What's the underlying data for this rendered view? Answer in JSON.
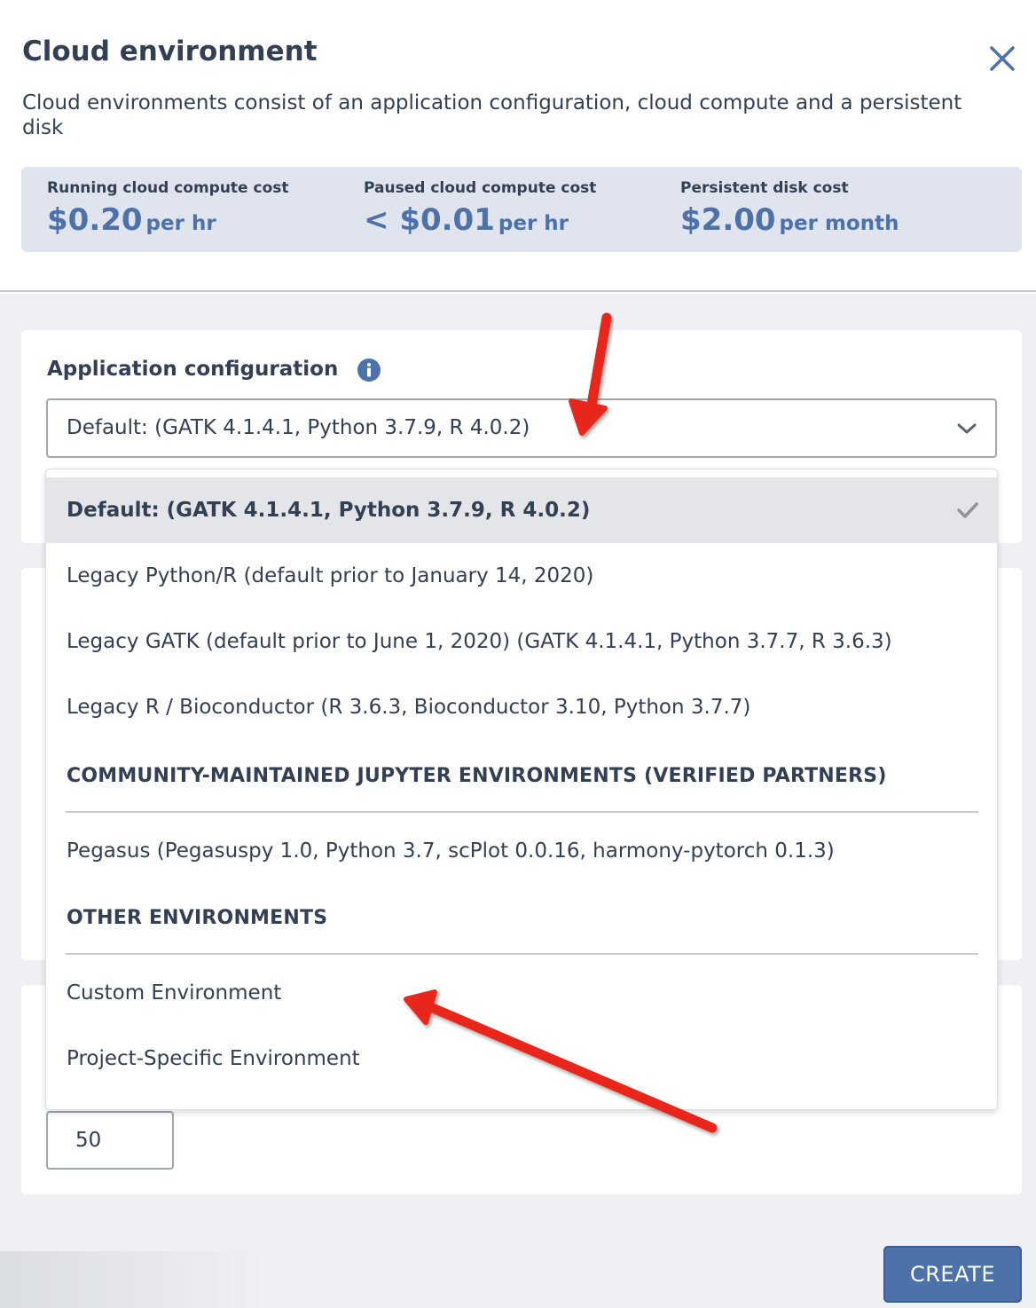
{
  "header": {
    "title": "Cloud environment",
    "description": "Cloud environments consist of an application configuration, cloud compute and a persistent disk"
  },
  "costs": [
    {
      "label": "Running cloud compute cost",
      "value": "$0.20",
      "unit": "per hr"
    },
    {
      "label": "Paused cloud compute cost",
      "value": "< $0.01",
      "unit": "per hr"
    },
    {
      "label": "Persistent disk cost",
      "value": "$2.00",
      "unit": "per month"
    }
  ],
  "app_config": {
    "label": "Application configuration",
    "selected_value": "Default: (GATK 4.1.4.1, Python 3.7.9, R 4.0.2)"
  },
  "dropdown": {
    "options": [
      "Default: (GATK 4.1.4.1, Python 3.7.9, R 4.0.2)",
      "Legacy Python/R (default prior to January 14, 2020)",
      "Legacy GATK (default prior to June 1, 2020) (GATK 4.1.4.1, Python 3.7.7, R 3.6.3)",
      "Legacy R / Bioconductor (R 3.6.3, Bioconductor 3.10, Python 3.7.7)"
    ],
    "community_header": "COMMUNITY-MAINTAINED JUPYTER ENVIRONMENTS (VERIFIED PARTNERS)",
    "community_options": [
      "Pegasus (Pegasuspy 1.0, Python 3.7, scPlot 0.0.16, harmony-pytorch 0.1.3)"
    ],
    "other_header": "OTHER ENVIRONMENTS",
    "other_options": [
      "Custom Environment",
      "Project-Specific Environment"
    ]
  },
  "disk_size": "50",
  "create_label": "CREATE",
  "colors": {
    "accent": "#4d72aa",
    "text": "#333f52",
    "cost_bg": "#dfe4ee",
    "panel_bg": "#eef0f4",
    "annotation_arrow": "#e8261a"
  },
  "icons": [
    "close-icon",
    "info-icon",
    "chevron-down-icon",
    "check-icon"
  ]
}
